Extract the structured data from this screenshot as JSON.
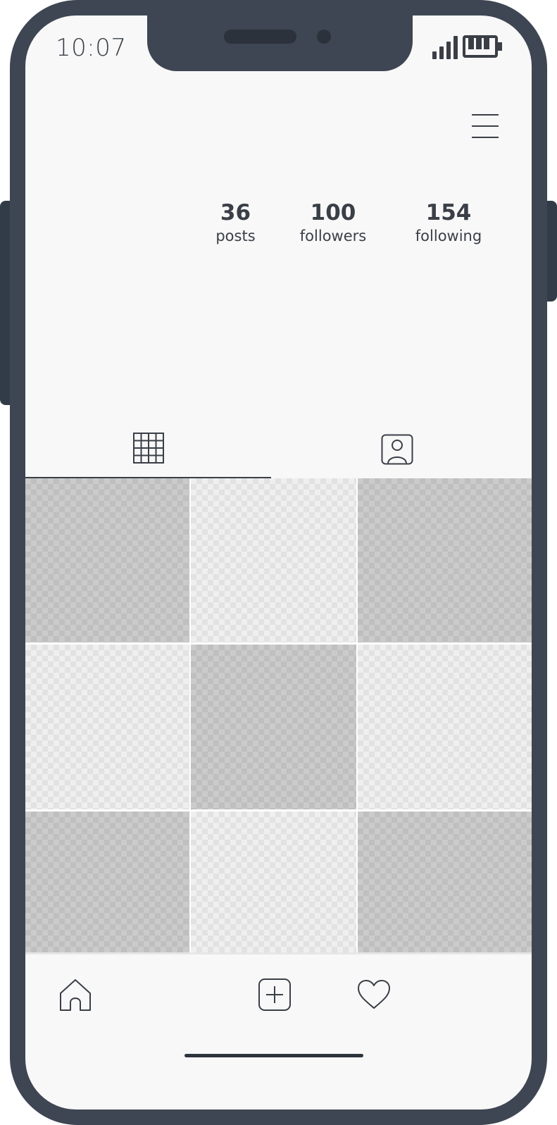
{
  "status_bar": {
    "time": "10:07",
    "signal_icon": "signal-bars-icon",
    "battery_icon": "battery-icon"
  },
  "header": {
    "menu_icon": "hamburger-menu-icon"
  },
  "profile": {
    "stats": [
      {
        "value": "36",
        "label": "posts"
      },
      {
        "value": "100",
        "label": "followers"
      },
      {
        "value": "154",
        "label": "following"
      }
    ]
  },
  "tabs": [
    {
      "icon": "grid-icon",
      "active": true
    },
    {
      "icon": "tagged-person-icon",
      "active": false
    }
  ],
  "posts": [
    "dark",
    "light",
    "dark",
    "light",
    "dark",
    "light",
    "dark",
    "light",
    "dark"
  ],
  "bottom_nav": [
    {
      "icon": "home-icon"
    },
    {
      "icon": "add-post-icon"
    },
    {
      "icon": "heart-icon"
    }
  ],
  "colors": {
    "frame": "#3e4653",
    "screen": "#f8f8f8",
    "ink": "#3a3f47"
  }
}
